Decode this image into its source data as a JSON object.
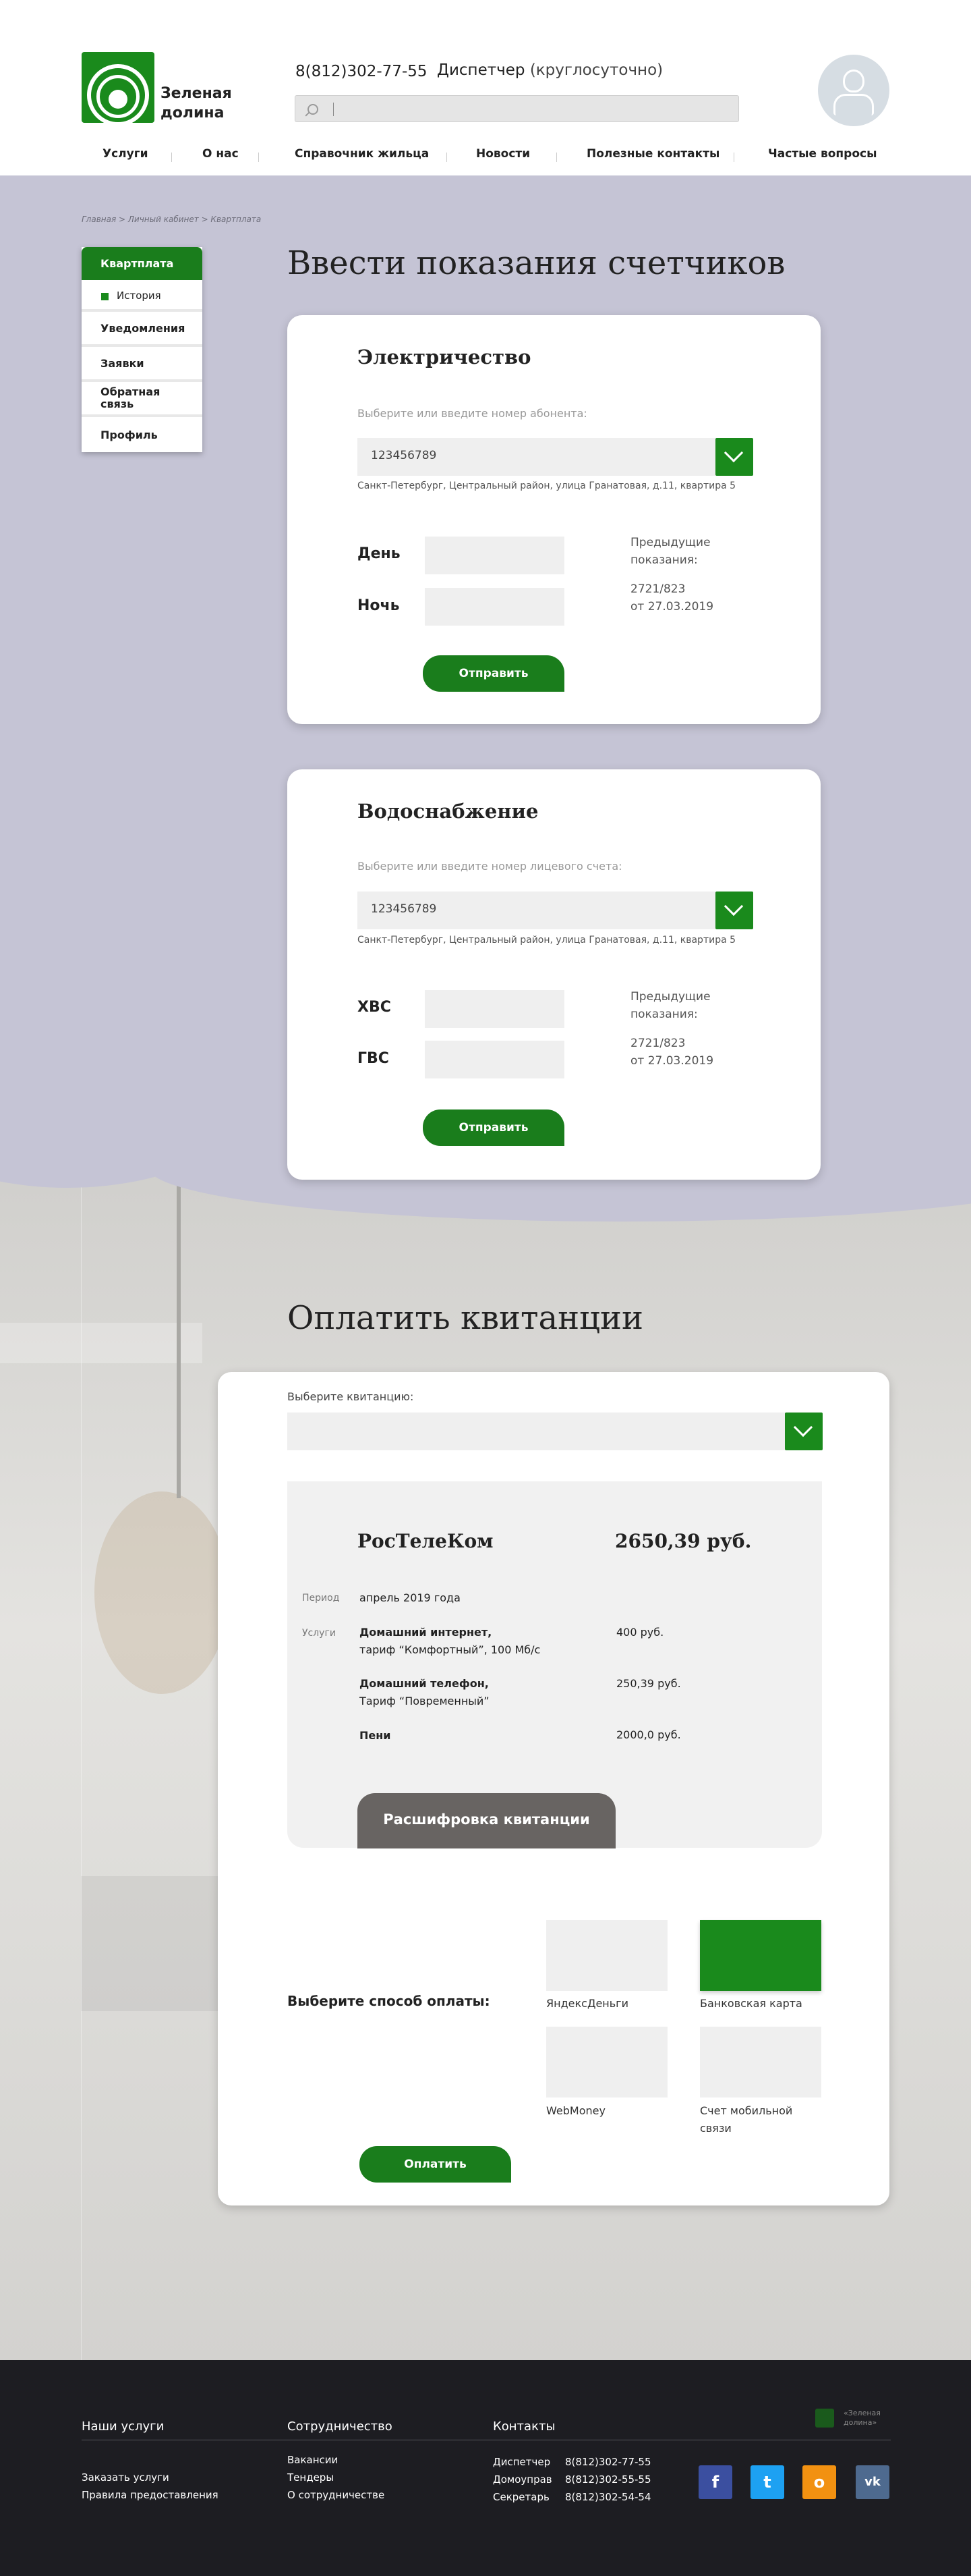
{
  "header": {
    "logo_text": "Зеленая долина",
    "phone": "8(812)302-77-55",
    "dispatcher_label": "Диспетчер",
    "dispatcher_note": "(круглосуточно)",
    "search_placeholder": ""
  },
  "nav": {
    "items": [
      {
        "label": "Услуги"
      },
      {
        "label": "О нас"
      },
      {
        "label": "Справочник жильца"
      },
      {
        "label": "Новости"
      },
      {
        "label": "Полезные контакты"
      },
      {
        "label": "Частые вопросы"
      }
    ]
  },
  "breadcrumbs": "Главная > Личный кабинет > Квартплата",
  "sidemenu": {
    "active": "Квартплата",
    "sub": "История",
    "items": [
      "Уведомления",
      "Заявки",
      "Обратная связь",
      "Профиль"
    ]
  },
  "meters": {
    "title": "Ввести показания счетчиков",
    "electricity": {
      "title": "Электричество",
      "hint": "Выберите или введите номер абонента:",
      "account": "123456789",
      "address": "Санкт-Петербург, Центральный район, улица Гранатовая,  д.11, квартира 5",
      "label1": "День",
      "label2": "Ночь",
      "prev_label": "Предыдущие показания:",
      "prev_value": "2721/823",
      "prev_date": "от 27.03.2019",
      "button": "Отправить"
    },
    "water": {
      "title": "Водоснабжение",
      "hint": "Выберите или введите номер лицевого счета:",
      "account": "123456789",
      "address": "Санкт-Петербург, Центральный район, улица Гранатовая,  д.11, квартира 5",
      "label1": "ХВС",
      "label2": "ГВС",
      "prev_label": "Предыдущие показания:",
      "prev_value": "2721/823",
      "prev_date": "от 27.03.2019",
      "button": "Отправить"
    }
  },
  "payment": {
    "title": "Оплатить квитанции",
    "receipt_label": "Выберите квитанцию:",
    "receipt_value": "",
    "bill": {
      "company": "РосТелеКом",
      "total": "2650,39 руб.",
      "period_label": "Период",
      "period_value": "апрель 2019 года",
      "services_label": "Услуги",
      "services": [
        {
          "line1": "Домашний интернет,",
          "line2": "тариф “Комфортный”, 100 Мб/с",
          "amount": "400 руб."
        },
        {
          "line1": "Домашний телефон,",
          "line2": "Тариф “Повременный”",
          "amount": "250,39 руб."
        },
        {
          "line1": "Пени",
          "line2": "",
          "amount": "2000,0 руб."
        }
      ],
      "detail_button": "Расшифровка квитанции"
    },
    "method_label": "Выберите способ оплаты:",
    "methods": [
      {
        "name": "ЯндексДеньги",
        "selected": false
      },
      {
        "name": "Банковская карта",
        "selected": true
      },
      {
        "name": "WebMoney",
        "selected": false
      },
      {
        "name": "Счет мобильной связи",
        "selected": false
      }
    ],
    "pay_button": "Оплатить"
  },
  "footer": {
    "col1_title": "Наши услуги",
    "col1_links": [
      "Заказать услуги",
      "Правила предоставления"
    ],
    "col2_title": "Сотрудничество",
    "col2_links": [
      "Вакансии",
      "Тендеры",
      "О сотрудничестве"
    ],
    "col3_title": "Контакты",
    "contacts": [
      {
        "role": "Диспетчер",
        "phone": "8(812)302-77-55"
      },
      {
        "role": "Домоуправ",
        "phone": "8(812)302-55-55"
      },
      {
        "role": "Секретарь",
        "phone": "8(812)302-54-54"
      }
    ],
    "logo_text": "«Зеленая долина»",
    "socials": [
      {
        "name": "facebook-icon",
        "glyph": "f",
        "color": "#3b4fa0"
      },
      {
        "name": "twitter-icon",
        "glyph": "t",
        "color": "#1da1f2"
      },
      {
        "name": "odnoklassniki-icon",
        "glyph": "о",
        "color": "#f29111"
      },
      {
        "name": "vk-icon",
        "glyph": "vk",
        "color": "#4e6a8f"
      }
    ]
  },
  "colors": {
    "accent": "#1a8a1c",
    "background": "#c5c4d5",
    "footer": "#1d1d22"
  }
}
